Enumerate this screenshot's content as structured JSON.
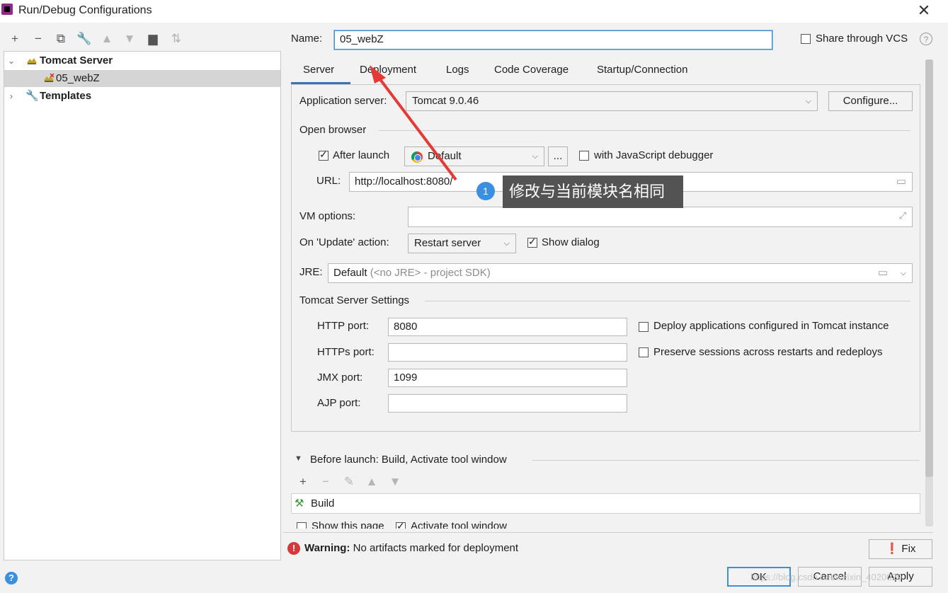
{
  "window": {
    "title": "Run/Debug Configurations"
  },
  "toolbar": {
    "icons": [
      "add-icon",
      "remove-icon",
      "copy-icon",
      "wrench-icon",
      "move-up-icon",
      "move-down-icon",
      "folder-icon",
      "sort-icon"
    ]
  },
  "tree": {
    "items": [
      {
        "label": "Tomcat Server",
        "expanded": true
      },
      {
        "label": "05_webZ",
        "selected": true
      },
      {
        "label": "Templates",
        "expanded": false
      }
    ]
  },
  "name": {
    "label": "Name:",
    "value": "05_webZ"
  },
  "share_vcs": {
    "label": "Share through VCS",
    "checked": false
  },
  "tabs": [
    "Server",
    "Deployment",
    "Logs",
    "Code Coverage",
    "Startup/Connection"
  ],
  "active_tab": "Server",
  "server": {
    "app_server_label": "Application server:",
    "app_server_value": "Tomcat 9.0.46",
    "configure_label": "Configure...",
    "open_browser_label": "Open browser",
    "after_launch_label": "After launch",
    "after_launch_checked": true,
    "browser_value": "Default",
    "ellipsis_label": "...",
    "js_debugger_label": "with JavaScript debugger",
    "js_debugger_checked": false,
    "url_label": "URL:",
    "url_value": "http://localhost:8080/",
    "vm_options_label": "VM options:",
    "vm_options_value": "",
    "on_update_label": "On 'Update' action:",
    "on_update_value": "Restart server",
    "show_dialog_label": "Show dialog",
    "show_dialog_checked": true,
    "jre_label": "JRE:",
    "jre_value": "Default",
    "jre_hint": "(<no JRE> - project SDK)",
    "tomcat_settings_label": "Tomcat Server Settings",
    "http_port_label": "HTTP port:",
    "http_port_value": "8080",
    "https_port_label": "HTTPs port:",
    "https_port_value": "",
    "jmx_port_label": "JMX port:",
    "jmx_port_value": "1099",
    "ajp_port_label": "AJP port:",
    "ajp_port_value": "",
    "deploy_apps_label": "Deploy applications configured in Tomcat instance",
    "deploy_apps_checked": false,
    "preserve_sessions_label": "Preserve sessions across restarts and redeploys",
    "preserve_sessions_checked": false
  },
  "annotation": {
    "badge": "1",
    "text": "修改与当前模块名相同",
    "color": "#e53935"
  },
  "before_launch": {
    "label": "Before launch: Build, Activate tool window",
    "items": [
      "Build"
    ],
    "show_page_label": "Show this page",
    "activate_tool_label": "Activate tool window"
  },
  "warning": {
    "prefix": "Warning:",
    "text": "No artifacts marked for deployment"
  },
  "buttons": {
    "fix": "Fix",
    "ok": "OK",
    "cancel": "Cancel",
    "apply": "Apply"
  },
  "watermark": "https://blog.csdn.net/weixin_4020029"
}
